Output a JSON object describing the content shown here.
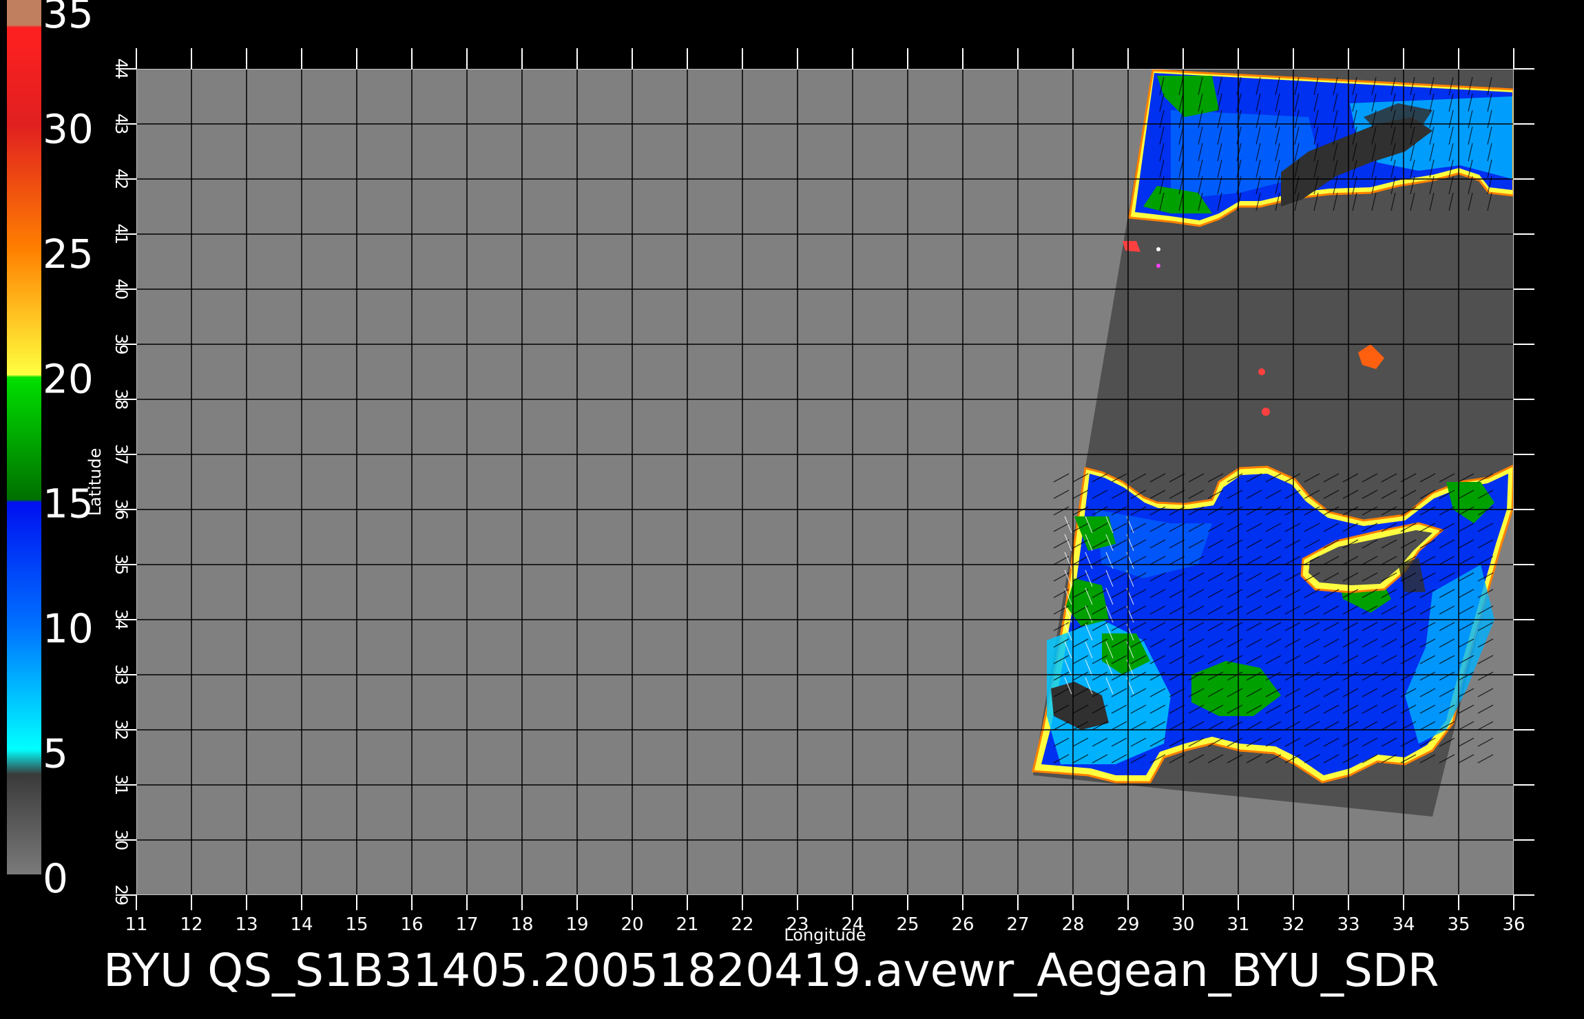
{
  "colorbar": {
    "labels": [
      "35",
      "30",
      "25",
      "20",
      "15",
      "10",
      "5",
      "0"
    ],
    "stops": [
      {
        "value": 0,
        "color": "#7a7a7a"
      },
      {
        "value": 4,
        "color": "#3a3a3a"
      },
      {
        "value": 5,
        "color": "#00ffff"
      },
      {
        "value": 10,
        "color": "#0070ff"
      },
      {
        "value": 14.9,
        "color": "#0010f0"
      },
      {
        "value": 15,
        "color": "#007000"
      },
      {
        "value": 19.9,
        "color": "#00e000"
      },
      {
        "value": 20,
        "color": "#ffff40"
      },
      {
        "value": 25,
        "color": "#ff8000"
      },
      {
        "value": 30,
        "color": "#e02020"
      },
      {
        "value": 33.9,
        "color": "#ff2020"
      },
      {
        "value": 34,
        "color": "#c08060"
      },
      {
        "value": 35,
        "color": "#c08060"
      }
    ]
  },
  "map": {
    "background_color": "#808080",
    "swath_shadow_color": "#505050",
    "grid_color": "#000000",
    "lon_range": [
      11,
      36
    ],
    "lat_range": [
      29,
      44
    ],
    "lon_ticks": [
      "11",
      "12",
      "13",
      "14",
      "15",
      "16",
      "17",
      "18",
      "19",
      "20",
      "21",
      "22",
      "23",
      "24",
      "25",
      "26",
      "27",
      "28",
      "29",
      "30",
      "31",
      "32",
      "33",
      "34",
      "35",
      "36"
    ],
    "lat_ticks": [
      "29",
      "30",
      "31",
      "32",
      "33",
      "34",
      "35",
      "36",
      "37",
      "38",
      "39",
      "40",
      "41",
      "42",
      "43",
      "44"
    ],
    "xlabel": "Longitude",
    "ylabel": "Latitude"
  },
  "footer": {
    "title": "BYU  QS_S1B31405.20051820419.avewr_Aegean_BYU_SDR"
  }
}
